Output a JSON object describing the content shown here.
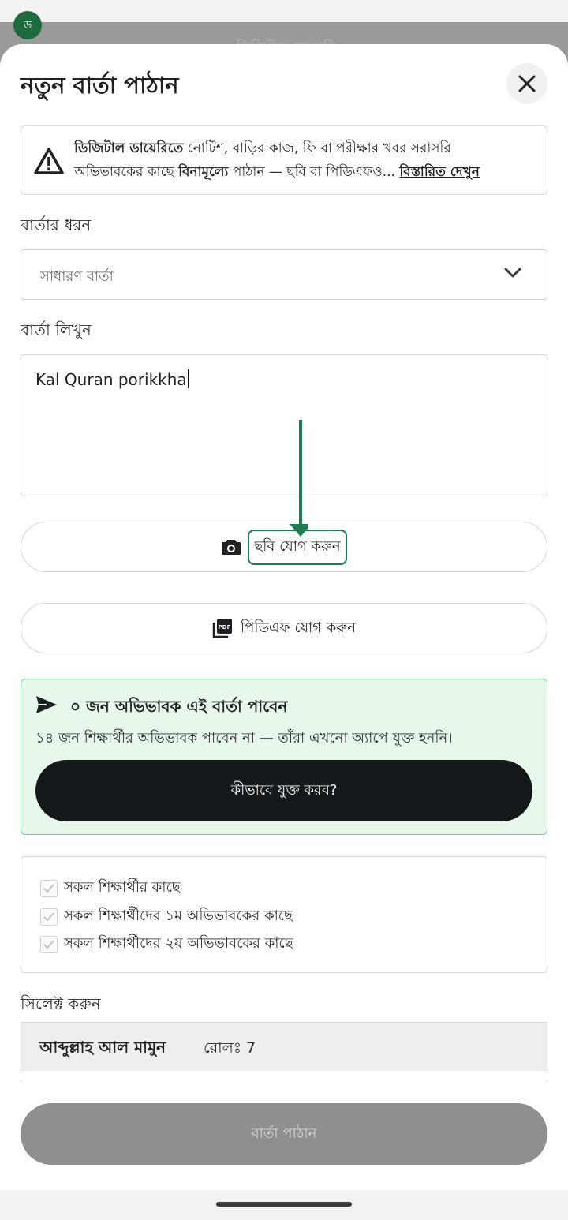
{
  "status_bar": {
    "badge": "ড"
  },
  "background_title": "ডিজিটাল ডায়েরি",
  "header": {
    "title": "নতুন বার্তা পাঠান"
  },
  "notice": {
    "bold_lead": "ডিজিটাল ডায়েরিতে",
    "line1_rest": " নোটিশ, বাড়ির কাজ, ফি বা পরীক্ষার খবর সরাসরি",
    "line2_pre": "অভিভাবকের কাছে ",
    "line2_bold": "বিনামূল্যে",
    "line2_post": " পাঠান — ছবি বা পিডিএফও... ",
    "link": "বিস্তারিত দেখুন"
  },
  "message_type": {
    "label": "বার্তার ধরন",
    "selected": "সাধারণ বার্তা"
  },
  "message": {
    "label": "বার্তা লিখুন",
    "value": "Kal Quran porikkha"
  },
  "attach": {
    "photo_label": "ছবি যোগ করুন",
    "pdf_label": "পিডিএফ যোগ করুন"
  },
  "recipients": {
    "headline": "০ জন অভিভাবক এই বার্তা পাবেন",
    "sub": "১৪ জন শিক্ষার্থীর অভিভাবক পাবেন না — তাঁরা এখনো অ্যাপে যুক্ত হননি।",
    "button": "কীভাবে যুক্ত করব?"
  },
  "audience_options": [
    "সকল শিক্ষার্থীর কাছে",
    "সকল শিক্ষার্থীদের ১ম অভিভাবকের কাছে",
    "সকল শিক্ষার্থীদের ২য় অভিভাবকের কাছে"
  ],
  "select_label": "সিলেক্ট করুন",
  "students": [
    {
      "name": "আব্দুল্লাহ আল মামুন",
      "roll": "রোলঃ 7"
    }
  ],
  "submit": {
    "label": "বার্তা পাঠান"
  },
  "colors": {
    "accent": "#1e7b4f",
    "info_bg": "#e7f8ea",
    "info_border": "#6fd48c",
    "dark_button": "#14181b",
    "disabled_button": "#8f8f8f"
  }
}
